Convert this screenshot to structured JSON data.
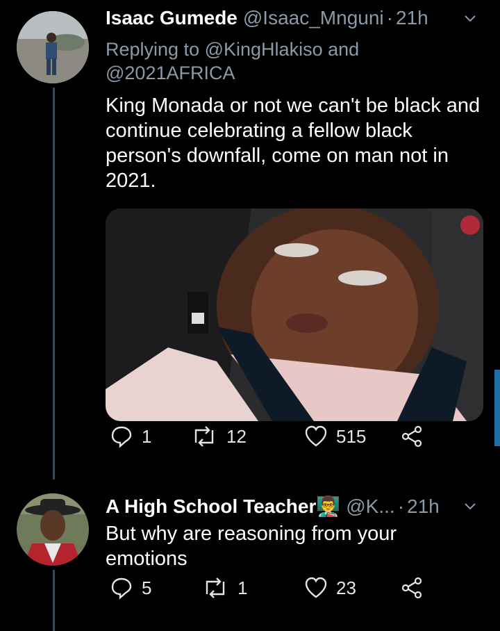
{
  "tweets": [
    {
      "name": "Isaac Gumede",
      "handle": "@Isaac_Mnguni",
      "time": "21h",
      "replying_prefix": "Replying to",
      "replying_to_1": "@KingHlakiso",
      "replying_and": "and",
      "replying_to_2": "@2021AFRICA",
      "text": "King Monada or not we can't be black and continue celebrating a fellow black person's downfall, come on man not in 2021.",
      "replies": "1",
      "retweets": "12",
      "likes": "515"
    },
    {
      "name": "A High School Teacher👨‍🏫",
      "handle": "@K...",
      "time": "21h",
      "text": "But why are reasoning from your emotions",
      "replies": "5",
      "retweets": "1",
      "likes": "23"
    }
  ],
  "separator": "·",
  "icons": {
    "reply": "reply-icon",
    "retweet": "retweet-icon",
    "like": "heart-icon",
    "share": "share-icon",
    "more": "chevron-down-icon"
  },
  "colors": {
    "background": "#000000",
    "secondary_text": "#8a9aa8",
    "thread_line": "#3d4a55",
    "scroll_indicator": "#1d6fa5"
  }
}
